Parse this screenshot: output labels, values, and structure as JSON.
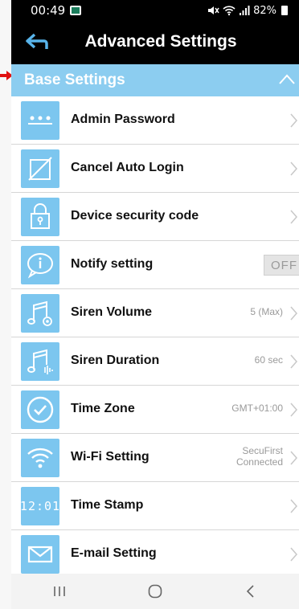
{
  "status_bar": {
    "time": "00:49",
    "battery": "82%"
  },
  "header": {
    "title": "Advanced Settings"
  },
  "section": {
    "title": "Base Settings"
  },
  "rows": [
    {
      "label": "Admin Password",
      "value": ""
    },
    {
      "label": "Cancel Auto Login",
      "value": ""
    },
    {
      "label": "Device security code",
      "value": ""
    },
    {
      "label": "Notify setting",
      "toggle": "OFF"
    },
    {
      "label": "Siren Volume",
      "value": "5 (Max)"
    },
    {
      "label": "Siren Duration",
      "value": "60 sec"
    },
    {
      "label": "Time Zone",
      "value": "GMT+01:00"
    },
    {
      "label": "Wi-Fi Setting",
      "value_line1": "SecuFirst",
      "value_line2": "Connected"
    },
    {
      "label": "Time Stamp",
      "value": "",
      "icon_text": "12:01"
    },
    {
      "label": "E-mail Setting",
      "value": ""
    }
  ],
  "colors": {
    "accent": "#8ccdf0",
    "icon_bg": "#7cc6ef",
    "pointer": "#e01010"
  },
  "icons": [
    "dots-icon",
    "no-login-icon",
    "lock-icon",
    "info-icon",
    "music-volume-icon",
    "music-duration-icon",
    "clock-check-icon",
    "wifi-icon",
    "digital-clock-icon",
    "envelope-icon"
  ]
}
